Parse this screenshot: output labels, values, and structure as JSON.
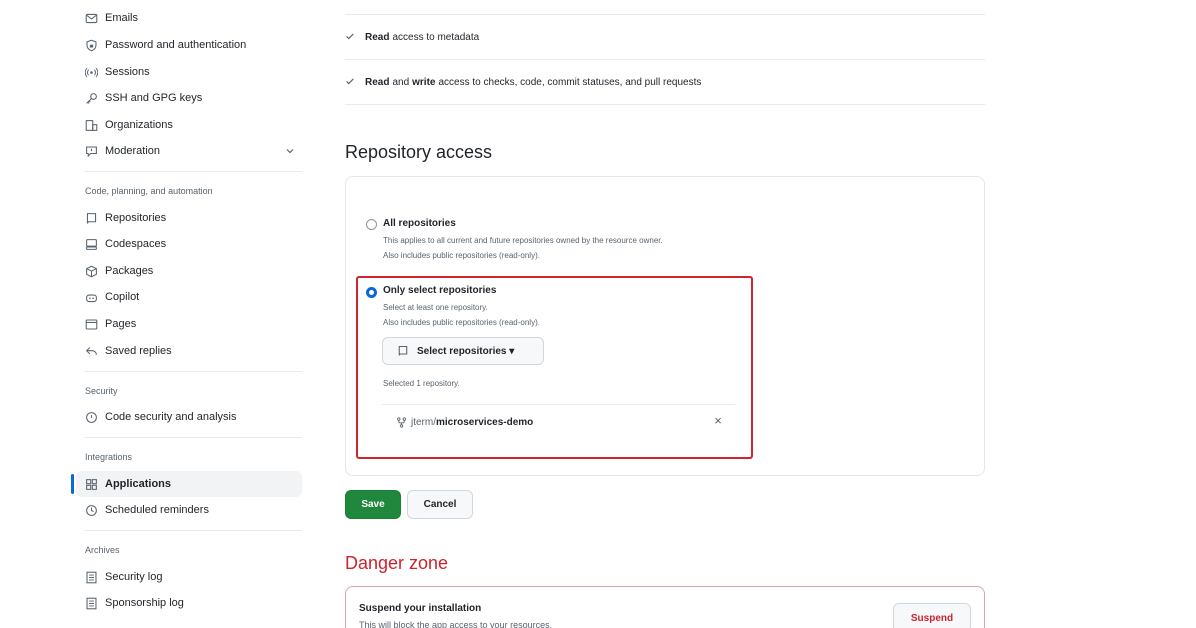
{
  "sidebar": {
    "items": [
      {
        "label": "Emails",
        "icon": "mail-icon"
      },
      {
        "label": "Password and authentication",
        "icon": "shield-lock-icon"
      },
      {
        "label": "Sessions",
        "icon": "broadcast-icon"
      },
      {
        "label": "SSH and GPG keys",
        "icon": "key-icon"
      },
      {
        "label": "Organizations",
        "icon": "organization-icon"
      },
      {
        "label": "Moderation",
        "icon": "report-icon"
      }
    ],
    "group_code": "Code, planning, and automation",
    "code_items": [
      {
        "label": "Repositories",
        "icon": "repo-icon"
      },
      {
        "label": "Codespaces",
        "icon": "codespaces-icon"
      },
      {
        "label": "Packages",
        "icon": "package-icon"
      },
      {
        "label": "Copilot",
        "icon": "copilot-icon"
      },
      {
        "label": "Pages",
        "icon": "browser-icon"
      },
      {
        "label": "Saved replies",
        "icon": "reply-icon"
      }
    ],
    "group_security": "Security",
    "security_items": [
      {
        "label": "Code security and analysis",
        "icon": "codescan-icon"
      }
    ],
    "group_integrations": "Integrations",
    "integration_items": [
      {
        "label": "Applications",
        "icon": "apps-icon"
      },
      {
        "label": "Scheduled reminders",
        "icon": "clock-icon"
      }
    ],
    "group_archives": "Archives",
    "archive_items": [
      {
        "label": "Security log",
        "icon": "log-icon"
      },
      {
        "label": "Sponsorship log",
        "icon": "log-icon"
      }
    ]
  },
  "permissions": {
    "row1": {
      "strong": "Read",
      "rest": "access to metadata"
    },
    "row2": {
      "strong1": "Read",
      "mid": "and",
      "strong2": "write",
      "rest": "access to checks, code, commit statuses, and pull requests"
    }
  },
  "repo_access": {
    "title": "Repository access",
    "all": {
      "title": "All repositories",
      "desc1": "This applies to all current and future repositories owned by the resource owner.",
      "desc2": "Also includes public repositories (read-only)."
    },
    "select": {
      "title": "Only select repositories",
      "desc1": "Select at least one repository.",
      "desc2": "Also includes public repositories (read-only).",
      "button": "Select repositories ▾",
      "selected_count": "Selected 1 repository.",
      "repo_owner": "jterm/",
      "repo_name": "microservices-demo",
      "remove": "×"
    }
  },
  "actions": {
    "save": "Save",
    "cancel": "Cancel"
  },
  "danger": {
    "title": "Danger zone",
    "suspend_title": "Suspend your installation",
    "suspend_desc": "This will block the app access to your resources.",
    "suspend_button": "Suspend"
  },
  "colors": {
    "accent": "#0969da",
    "save_green": "#1f883d",
    "danger_red": "#cf222e",
    "highlight_red": "#d1242f"
  }
}
